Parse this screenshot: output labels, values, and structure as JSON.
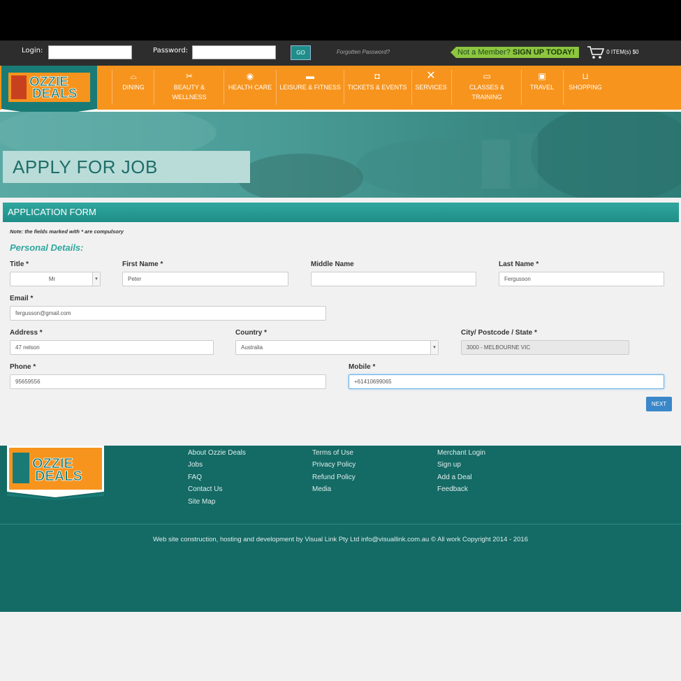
{
  "login_bar": {
    "login_label": "Login:",
    "password_label": "Password:",
    "go_label": "GO",
    "forgot_label": "Forgotten Password?",
    "member_prefix": "Not a Member?",
    "member_cta": "SIGN UP TODAY!",
    "cart_text": "0 ITEM(s) $0"
  },
  "logo": {
    "line1": "OZZIE",
    "line2": "DEALS"
  },
  "nav": {
    "items": [
      {
        "label": "DINING",
        "icon": "dining-icon"
      },
      {
        "label": "BEAUTY & WELLNESS",
        "icon": "scissors-icon"
      },
      {
        "label": "HEALTH CARE",
        "icon": "drop-icon"
      },
      {
        "label": "LEISURE & FITNESS",
        "icon": "shoe-icon"
      },
      {
        "label": "TICKETS & EVENTS",
        "icon": "camera-icon"
      },
      {
        "label": "SERVICES",
        "icon": "tools-icon"
      },
      {
        "label": "CLASSES & TRAINING",
        "icon": "projector-icon"
      },
      {
        "label": "TRAVEL",
        "icon": "suitcase-icon"
      },
      {
        "label": "SHOPPING",
        "icon": "basket-icon"
      }
    ]
  },
  "hero": {
    "title": "APPLY FOR JOB"
  },
  "form": {
    "header": "APPLICATION FORM",
    "note": "Note: the fields marked with * are compulsory",
    "section_title": "Personal Details:",
    "title_label": "Title *",
    "title_value": "Mr",
    "first_name_label": "First Name *",
    "first_name_value": "Peter",
    "middle_name_label": "Middle Name",
    "middle_name_value": "",
    "last_name_label": "Last Name *",
    "last_name_value": "Fergusson",
    "email_label": "Email *",
    "email_value": "fergusson@gmail.com",
    "address_label": "Address *",
    "address_value": "47 nelson",
    "country_label": "Country *",
    "country_value": "Australia",
    "city_label": "City/ Postcode / State *",
    "city_value": "3000 - MELBOURNE VIC",
    "phone_label": "Phone *",
    "phone_value": "95659556",
    "mobile_label": "Mobile *",
    "mobile_value": "+61410699065",
    "next_label": "NEXT"
  },
  "footer": {
    "col1": [
      "About Ozzie Deals",
      "Jobs",
      "FAQ",
      "Contact Us",
      "Site Map"
    ],
    "col2": [
      "Terms of Use",
      "Privacy Policy",
      "Refund Policy",
      "Media"
    ],
    "col3": [
      "Merchant Login",
      "Sign up",
      "Add a Deal",
      "Feedback"
    ],
    "copyright": "Web site construction, hosting and development by Visual Link Pty Ltd info@visuallink.com.au © All work Copyright 2014 - 2016"
  },
  "colors": {
    "orange": "#f7941d",
    "teal": "#146a65",
    "accent": "#2fa79f",
    "green": "#8dc63f"
  }
}
